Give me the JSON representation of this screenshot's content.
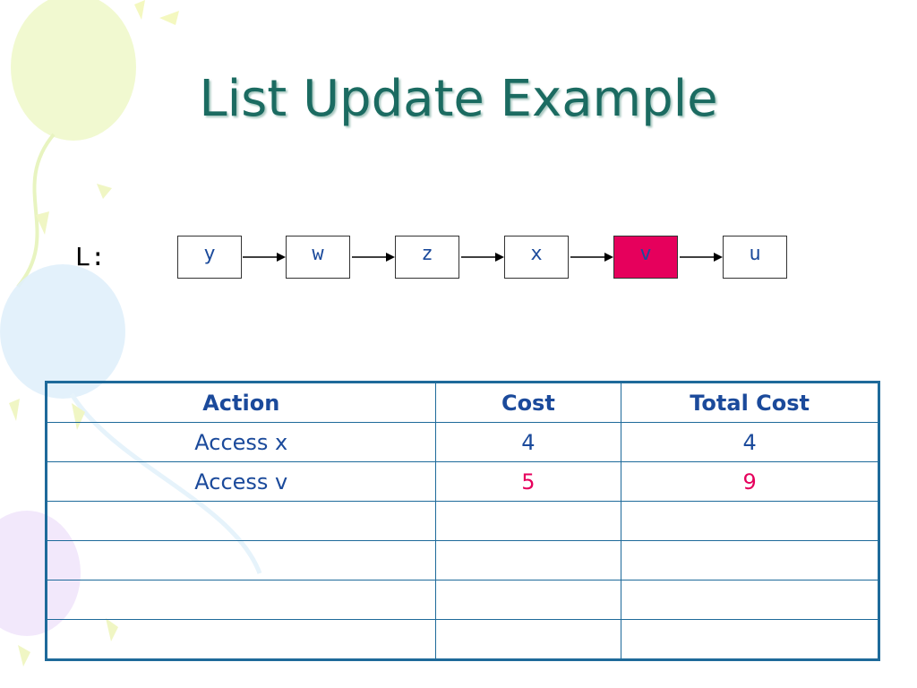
{
  "title": "List Update Example",
  "list_label": "L:",
  "nodes": [
    "y",
    "w",
    "z",
    "x",
    "v",
    "u"
  ],
  "highlight_node": "v",
  "colors": {
    "title": "#1b6b61",
    "highlight": "#e6005c",
    "table_border": "#1e6a9a",
    "text": "#1b4a9b"
  },
  "table": {
    "headers": [
      "Action",
      "Cost",
      "Total Cost"
    ],
    "rows": [
      [
        "Access x",
        "4",
        "4"
      ],
      [
        "Access v",
        "5",
        "9"
      ],
      [
        "",
        "",
        ""
      ],
      [
        "",
        "",
        ""
      ],
      [
        "",
        "",
        ""
      ],
      [
        "",
        "",
        ""
      ]
    ]
  }
}
